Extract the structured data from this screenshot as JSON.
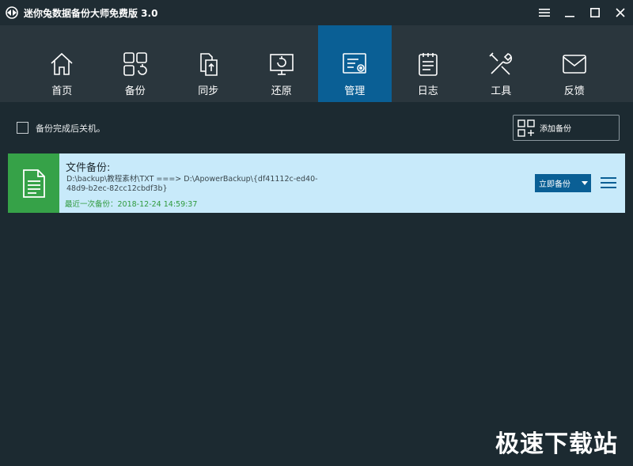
{
  "window": {
    "title": "迷你兔数据备份大师免费版 3.0",
    "controls": [
      "menu-icon",
      "minimize-icon",
      "maximize-icon",
      "close-icon"
    ]
  },
  "nav": {
    "items": [
      {
        "label": "首页",
        "icon": "home-icon"
      },
      {
        "label": "备份",
        "icon": "backup-icon"
      },
      {
        "label": "同步",
        "icon": "sync-icon"
      },
      {
        "label": "还原",
        "icon": "restore-icon"
      },
      {
        "label": "管理",
        "icon": "manage-icon",
        "active": true
      },
      {
        "label": "日志",
        "icon": "log-icon"
      },
      {
        "label": "工具",
        "icon": "tools-icon"
      },
      {
        "label": "反馈",
        "icon": "feedback-icon"
      }
    ]
  },
  "options": {
    "shutdown_label": "备份完成后关机。",
    "add_backup_label": "添加备份"
  },
  "task": {
    "name": "文件备份:",
    "path": "D:\\backup\\教程素材\\TXT ===> D:\\ApowerBackup\\{df41112c-ed40-48d9-b2ec-82cc12cbdf3b}",
    "last_backup": "最近一次备份：2018-12-24 14:59:37",
    "run_label": "立即备份"
  },
  "watermark": "极速下载站",
  "colors": {
    "accent": "#0a5f95",
    "card_bg": "#c8eafa",
    "card_icon_bg": "#36a248",
    "last_backup_text": "#2f9a3d"
  }
}
